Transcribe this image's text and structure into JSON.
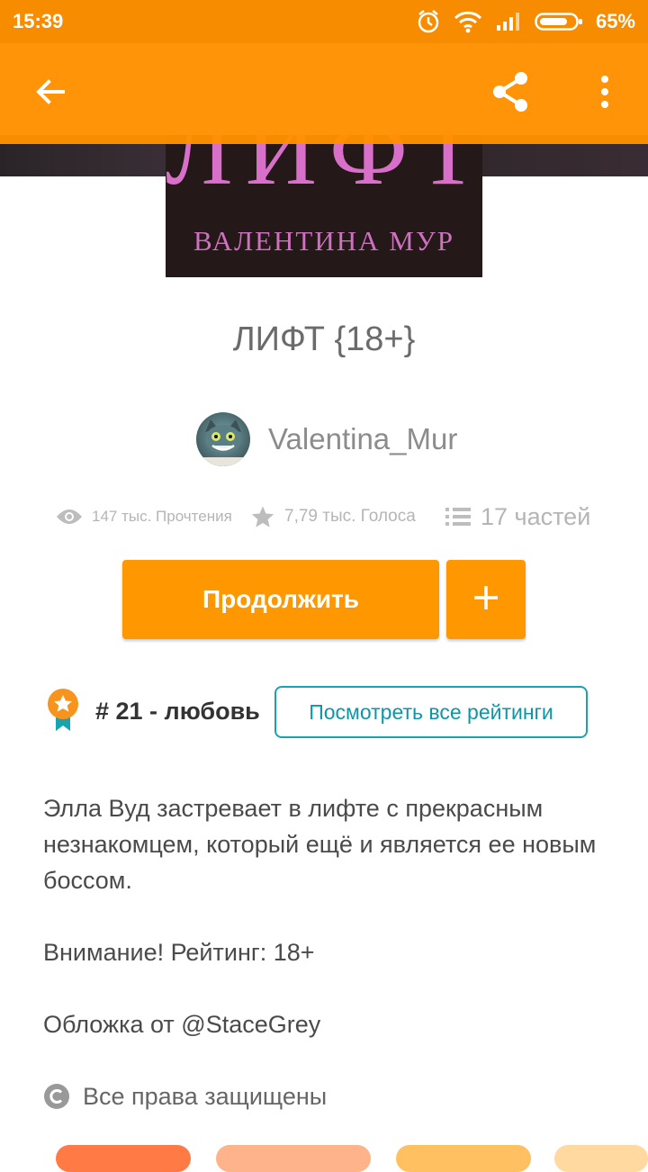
{
  "status_bar": {
    "time": "15:39",
    "battery": "65%"
  },
  "cover": {
    "title": "ЛИФТ",
    "author": "ВАЛЕНТИНА МУР"
  },
  "story": {
    "title": "ЛИФТ {18+}",
    "author": "Valentina_Mur"
  },
  "stats": {
    "reads": "147 тыс. Прочтения",
    "votes": "7,79 тыс. Голоса",
    "parts": "17 частей"
  },
  "actions": {
    "continue_label": "Продолжить",
    "add_label": "+"
  },
  "ranking": {
    "text": "# 21 - любовь",
    "view_all_label": "Посмотреть все рейтинги"
  },
  "description": {
    "para1": "Элла Вуд застревает в лифте с прекрасным незнакомцем, который ещё и является ее новым боссом.",
    "para2": "Внимание! Рейтинг: 18+",
    "para3": "Обложка от @StaceGrey"
  },
  "copyright": "Все права защищены",
  "colors": {
    "accent": "#FF9800",
    "status_bar": "#F78C00",
    "link": "#17a3b0",
    "tags": [
      "#FF7A45",
      "#FFB38A",
      "#FFC062",
      "#FFD9A0"
    ]
  },
  "icons": [
    "back-arrow",
    "share",
    "more-vert",
    "eye",
    "star",
    "list",
    "medal",
    "copyright",
    "alarm",
    "wifi",
    "signal",
    "battery"
  ]
}
